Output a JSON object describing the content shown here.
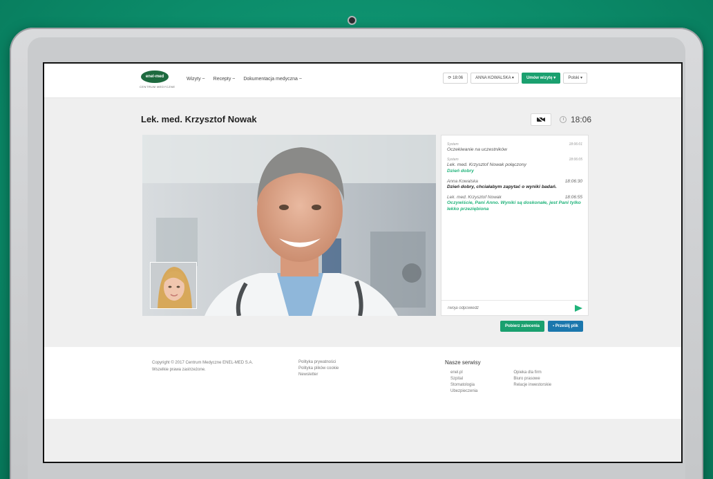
{
  "header": {
    "logo_text": "enel-med",
    "logo_sub": "CENTRUM MEDYCZNE",
    "nav": [
      "Wizyty ~",
      "Recepty ~",
      "Dokumentacja medyczna ~"
    ],
    "time_button": "⟳ 18:06",
    "user_button": "ANNA KOWALSKA ▾",
    "book_button": "Umów wizytę ▾",
    "lang_button": "Polski ▾"
  },
  "consult": {
    "doctor_title": "Lek. med. Krzysztof Nowak",
    "clock": "18:06"
  },
  "chat": {
    "messages": [
      {
        "author": "System",
        "time": "18:06:01",
        "text": "Oczekiwanie na uczestników",
        "style": "plain"
      },
      {
        "author": "System",
        "time": "18:06:05",
        "text": "Lek. med. Krzysztof Nowak połączony",
        "text2": "Dzień dobry",
        "style": "join"
      },
      {
        "author": "Anna Kowalska",
        "time": "18:06:30",
        "text": "Dzień dobry, chciałabym zapytać o wyniki badań.",
        "style": "patient"
      },
      {
        "author": "Lek. med. Krzysztof Nowak",
        "time": "18:06:55",
        "text": "Oczywiście, Pani Anno. Wyniki są doskonałe, jest Pani tylko lekko przeziębiona",
        "style": "doctor"
      }
    ],
    "input_placeholder": "Twoja odpowiedź"
  },
  "actions": {
    "download_label": "Pobierz zalecenia",
    "send_file_label": "Prześlij plik"
  },
  "footer": {
    "copyright_1": "Copyright © 2017 Centrum Medyczne ENEL-MED S.A.",
    "copyright_2": "Wszelkie prawa zastrzeżone.",
    "links": [
      "Polityka prywatności",
      "Polityka plików cookie",
      "Newsletter"
    ],
    "services_title": "Nasze serwisy",
    "services_col1": [
      "enel.pl",
      "Szpital",
      "Stomatologia",
      "Ubezpieczenia"
    ],
    "services_col2": [
      "Opieka dla firm",
      "Biuro prasowe",
      "Relacje inwestorskie"
    ]
  },
  "colors": {
    "background_green": "#0b8a68",
    "accent_green": "#1aa06f",
    "chat_green": "#20b37a",
    "button_blue": "#1b77ad"
  }
}
